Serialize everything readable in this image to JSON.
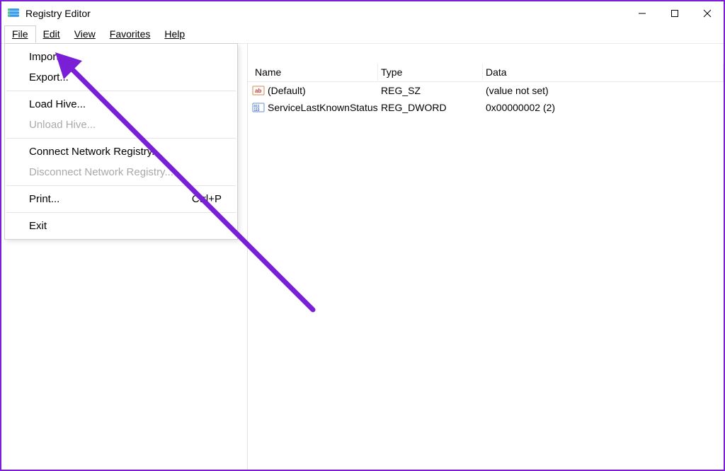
{
  "window": {
    "title": "Registry Editor"
  },
  "menubar": {
    "file": "File",
    "edit": "Edit",
    "view": "View",
    "favorites": "Favorites",
    "help": "Help"
  },
  "file_menu": {
    "import": "Import...",
    "export": "Export...",
    "load_hive": "Load Hive...",
    "unload_hive": "Unload Hive...",
    "connect_network": "Connect Network Registry...",
    "disconnect_network": "Disconnect Network Registry...",
    "print": "Print...",
    "print_shortcut": "Ctrl+P",
    "exit": "Exit"
  },
  "list": {
    "headers": {
      "name": "Name",
      "type": "Type",
      "data": "Data"
    },
    "rows": [
      {
        "icon": "string",
        "name": "(Default)",
        "type": "REG_SZ",
        "data": "(value not set)"
      },
      {
        "icon": "binary",
        "name": "ServiceLastKnownStatus",
        "type": "REG_DWORD",
        "data": "0x00000002 (2)"
      }
    ]
  },
  "annotation": {
    "color": "#7a1fd6"
  }
}
